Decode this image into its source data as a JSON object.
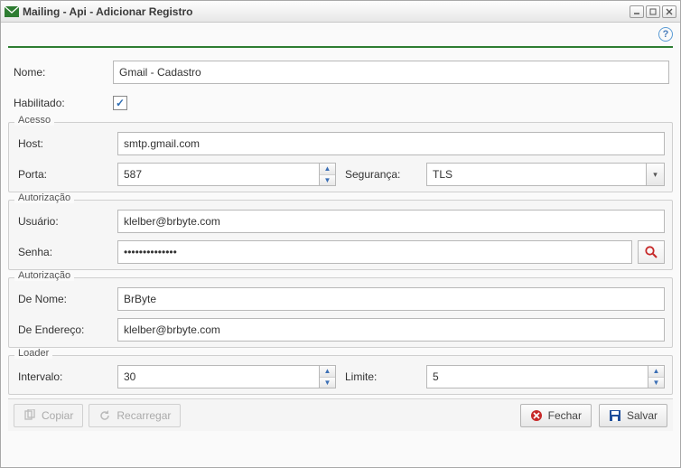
{
  "window": {
    "title": "Mailing - Api - Adicionar Registro"
  },
  "fields": {
    "nome_label": "Nome:",
    "nome_value": "Gmail - Cadastro",
    "habilitado_label": "Habilitado:",
    "habilitado_checked": true
  },
  "acesso": {
    "legend": "Acesso",
    "host_label": "Host:",
    "host_value": "smtp.gmail.com",
    "porta_label": "Porta:",
    "porta_value": "587",
    "seguranca_label": "Segurança:",
    "seguranca_value": "TLS"
  },
  "auth1": {
    "legend": "Autorização",
    "usuario_label": "Usuário:",
    "usuario_value": "klelber@brbyte.com",
    "senha_label": "Senha:",
    "senha_value": "••••••••••••••"
  },
  "auth2": {
    "legend": "Autorização",
    "de_nome_label": "De Nome:",
    "de_nome_value": "BrByte",
    "de_endereco_label": "De Endereço:",
    "de_endereco_value": "klelber@brbyte.com"
  },
  "loader": {
    "legend": "Loader",
    "intervalo_label": "Intervalo:",
    "intervalo_value": "30",
    "limite_label": "Limite:",
    "limite_value": "5"
  },
  "footer": {
    "copiar": "Copiar",
    "recarregar": "Recarregar",
    "fechar": "Fechar",
    "salvar": "Salvar"
  }
}
